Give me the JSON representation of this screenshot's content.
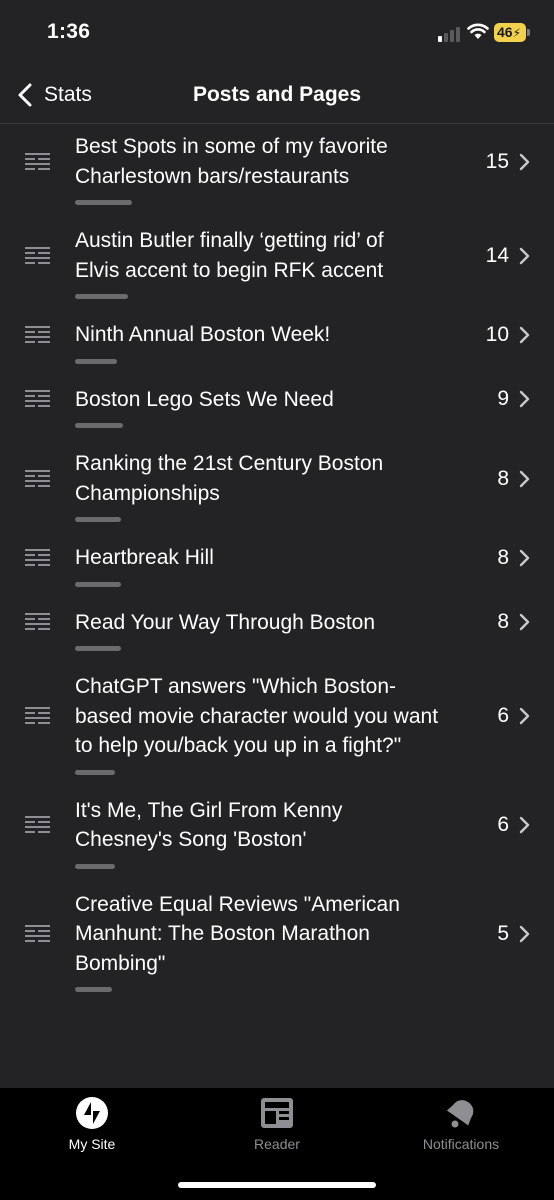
{
  "status_bar": {
    "time": "1:36",
    "battery": "46",
    "icons": [
      "signal-icon",
      "wifi-icon",
      "battery-charging-icon"
    ]
  },
  "nav": {
    "back_label": "Stats",
    "title": "Posts and Pages",
    "icon": "chevron-left-icon"
  },
  "posts": [
    {
      "title_lines": [
        "Best Spots in some of my favorite",
        "Charlestown bars/restaurants"
      ],
      "count": "15"
    },
    {
      "title_lines": [
        "Austin Butler finally ‘getting rid’ of",
        "Elvis accent to begin RFK accent"
      ],
      "count": "14"
    },
    {
      "title_lines": [
        "Ninth Annual Boston Week!"
      ],
      "count": "10"
    },
    {
      "title_lines": [
        "Boston Lego Sets We Need"
      ],
      "count": "9"
    },
    {
      "title_lines": [
        "Ranking the 21st Century Boston",
        "Championships"
      ],
      "count": "8"
    },
    {
      "title_lines": [
        "Heartbreak Hill"
      ],
      "count": "8"
    },
    {
      "title_lines": [
        "Read Your Way Through Boston"
      ],
      "count": "8"
    },
    {
      "title_lines": [
        "ChatGPT answers \"Which Boston-",
        "based movie character would you want",
        "to help you/back you up in a fight?\""
      ],
      "count": "6"
    },
    {
      "title_lines": [
        "It's Me, The Girl From Kenny",
        "Chesney's Song 'Boston'"
      ],
      "count": "6"
    },
    {
      "title_lines": [
        "Creative Equal Reviews \"American",
        "Manhunt: The Boston Marathon",
        "Bombing\""
      ],
      "count": "5"
    }
  ],
  "tabs": [
    {
      "label": "My Site",
      "icon": "jetpack-bolt-icon",
      "active": true
    },
    {
      "label": "Reader",
      "icon": "reader-newspaper-icon",
      "active": false
    },
    {
      "label": "Notifications",
      "icon": "bell-icon",
      "active": false
    }
  ],
  "colors": {
    "background": "#232325",
    "tab_bar": "#000000",
    "muted": "#8e8e93",
    "battery": "#f2d14c"
  }
}
